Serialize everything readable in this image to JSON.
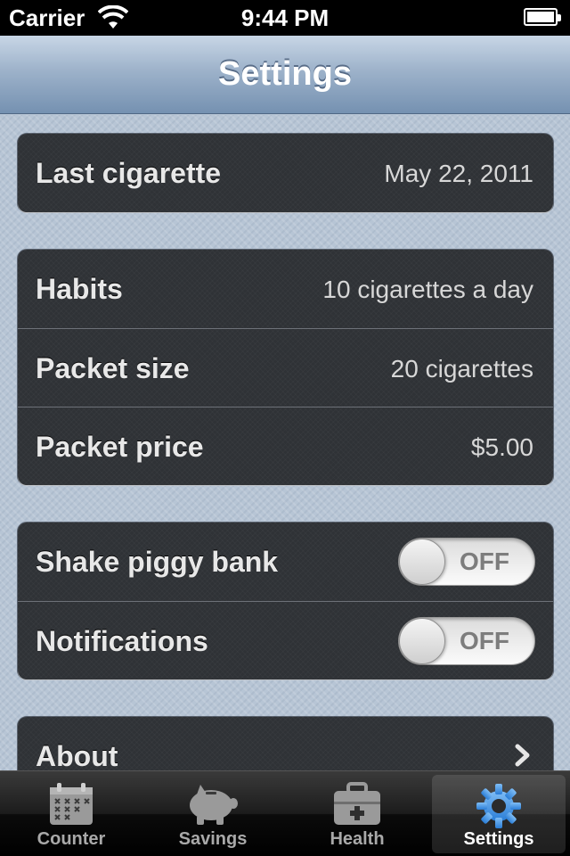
{
  "status_bar": {
    "carrier": "Carrier",
    "time": "9:44 PM",
    "icons": [
      "wifi-icon",
      "battery-icon"
    ]
  },
  "nav_bar": {
    "title": "Settings"
  },
  "groups": {
    "quit": {
      "last_cigarette_label": "Last cigarette",
      "last_cigarette_value": "May 22, 2011"
    },
    "habits": {
      "habits_label": "Habits",
      "habits_value": "10 cigarettes a day",
      "packet_size_label": "Packet size",
      "packet_size_value": "20 cigarettes",
      "packet_price_label": "Packet price",
      "packet_price_value": "$5.00"
    },
    "toggles": {
      "shake_label": "Shake piggy bank",
      "shake_state": "OFF",
      "notifications_label": "Notifications",
      "notifications_state": "OFF"
    },
    "info": {
      "about_label": "About",
      "about_icon": "chevron-right-icon"
    }
  },
  "tab_bar": {
    "tabs": [
      {
        "label": "Counter",
        "icon": "calendar-icon",
        "selected": false
      },
      {
        "label": "Savings",
        "icon": "piggy-bank-icon",
        "selected": false
      },
      {
        "label": "Health",
        "icon": "first-aid-kit-icon",
        "selected": false
      },
      {
        "label": "Settings",
        "icon": "gear-icon",
        "selected": true
      }
    ]
  },
  "colors": {
    "accent_blue": "#4a90e2",
    "cell_background": "#2f3236",
    "page_background": "#b7c5d5"
  }
}
